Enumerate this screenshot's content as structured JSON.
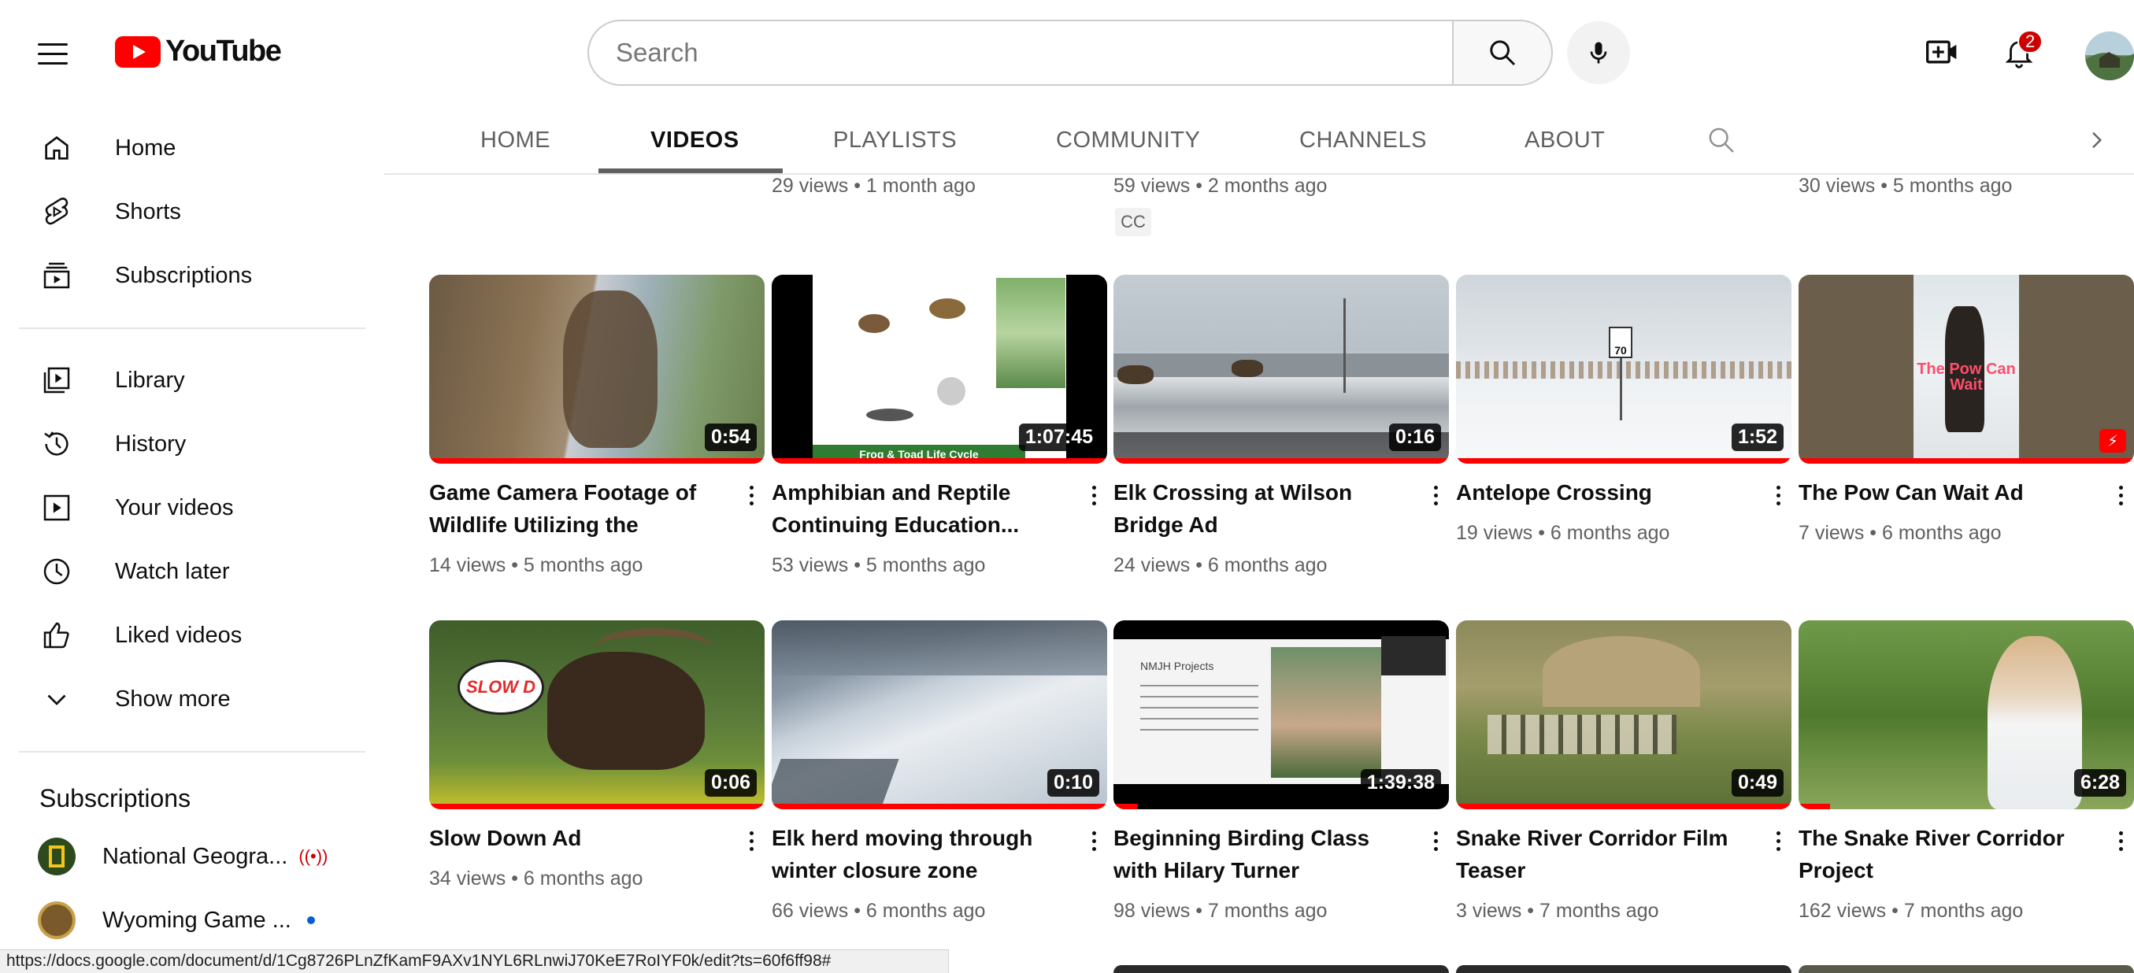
{
  "app": {
    "logo_text": "YouTube",
    "brand_color": "#ff0000"
  },
  "search": {
    "placeholder": "Search"
  },
  "notifications": {
    "count": "2"
  },
  "sidebar": {
    "items": [
      {
        "label": "Home",
        "icon": "home-icon"
      },
      {
        "label": "Shorts",
        "icon": "shorts-icon"
      },
      {
        "label": "Subscriptions",
        "icon": "subscriptions-icon"
      },
      {
        "label": "Library",
        "icon": "library-icon"
      },
      {
        "label": "History",
        "icon": "history-icon"
      },
      {
        "label": "Your videos",
        "icon": "your-videos-icon"
      },
      {
        "label": "Watch later",
        "icon": "watch-later-icon"
      },
      {
        "label": "Liked videos",
        "icon": "liked-videos-icon"
      },
      {
        "label": "Show more",
        "icon": "chevron-down-icon"
      }
    ],
    "subscriptions_heading": "Subscriptions",
    "subscriptions": [
      {
        "name": "National Geogra...",
        "indicator": "live"
      },
      {
        "name": "Wyoming Game ...",
        "indicator": "new"
      }
    ]
  },
  "tabs": [
    {
      "label": "HOME",
      "active": false
    },
    {
      "label": "VIDEOS",
      "active": true
    },
    {
      "label": "PLAYLISTS",
      "active": false
    },
    {
      "label": "COMMUNITY",
      "active": false
    },
    {
      "label": "CHANNELS",
      "active": false
    },
    {
      "label": "ABOUT",
      "active": false
    }
  ],
  "previous_row": [
    {
      "meta": "29 views • 1 month ago"
    },
    {
      "meta": "59 views • 2 months ago",
      "badge": "CC"
    },
    {
      "meta": "30 views • 5 months ago"
    }
  ],
  "videos": [
    {
      "title": "Game Camera Footage of Wildlife Utilizing the Teton...",
      "duration": "0:54",
      "meta": "14 views • 5 months ago"
    },
    {
      "title": "Amphibian and Reptile Continuing Education...",
      "duration": "1:07:45",
      "meta": "53 views • 5 months ago",
      "thumb_caption": "Frog & Toad Life Cycle"
    },
    {
      "title": "Elk Crossing at Wilson Bridge Ad",
      "duration": "0:16",
      "meta": "24 views • 6 months ago"
    },
    {
      "title": "Antelope Crossing",
      "duration": "1:52",
      "meta": "19 views • 6 months ago",
      "thumb_caption": "70"
    },
    {
      "title": "The Pow Can Wait Ad",
      "duration": "",
      "meta": "7 views • 6 months ago",
      "thumb_caption": "The Pow Can Wait"
    },
    {
      "title": "Slow Down Ad",
      "duration": "0:06",
      "meta": "34 views • 6 months ago",
      "thumb_caption": "SLOW D"
    },
    {
      "title": "Elk herd moving through winter closure zone",
      "duration": "0:10",
      "meta": "66 views • 6 months ago"
    },
    {
      "title": "Beginning Birding Class with Hilary Turner",
      "duration": "1:39:38",
      "meta": "98 views • 7 months ago",
      "thumb_caption": "NMJH Projects"
    },
    {
      "title": "Snake River Corridor Film Teaser",
      "duration": "0:49",
      "meta": "3 views • 7 months ago"
    },
    {
      "title": "The Snake River Corridor Project",
      "duration": "6:28",
      "meta": "162 views • 7 months ago"
    }
  ],
  "status_url": "https://docs.google.com/document/d/1Cg8726PLnZfKamF9AXv1NYL6RLnwiJ70KeE7RoIYF0k/edit?ts=60f6ff98#"
}
